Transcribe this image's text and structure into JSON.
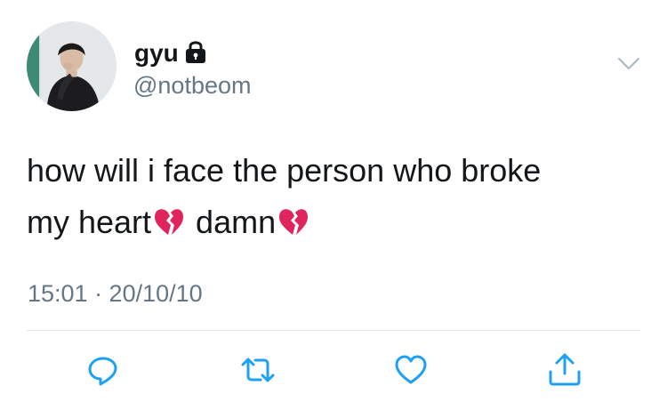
{
  "tweet": {
    "author": {
      "display_name": "gyu",
      "handle": "@notbeom",
      "protected_icon": "lock-icon",
      "avatar": "profile-photo"
    },
    "text_line1": "how will i face the person who broke",
    "text_line2_part1": "my heart",
    "text_line2_part2": "damn",
    "emoji": "broken-heart",
    "timestamp": "15:01 · 20/10/10"
  },
  "actions": [
    {
      "icon": "reply-icon"
    },
    {
      "icon": "retweet-icon"
    },
    {
      "icon": "like-icon"
    },
    {
      "icon": "share-icon"
    }
  ],
  "colors": {
    "text": "#14171a",
    "secondary": "#657786",
    "action_icon": "#1da1f2",
    "emoji": "#e0245e",
    "divider": "#e1e8ed"
  }
}
